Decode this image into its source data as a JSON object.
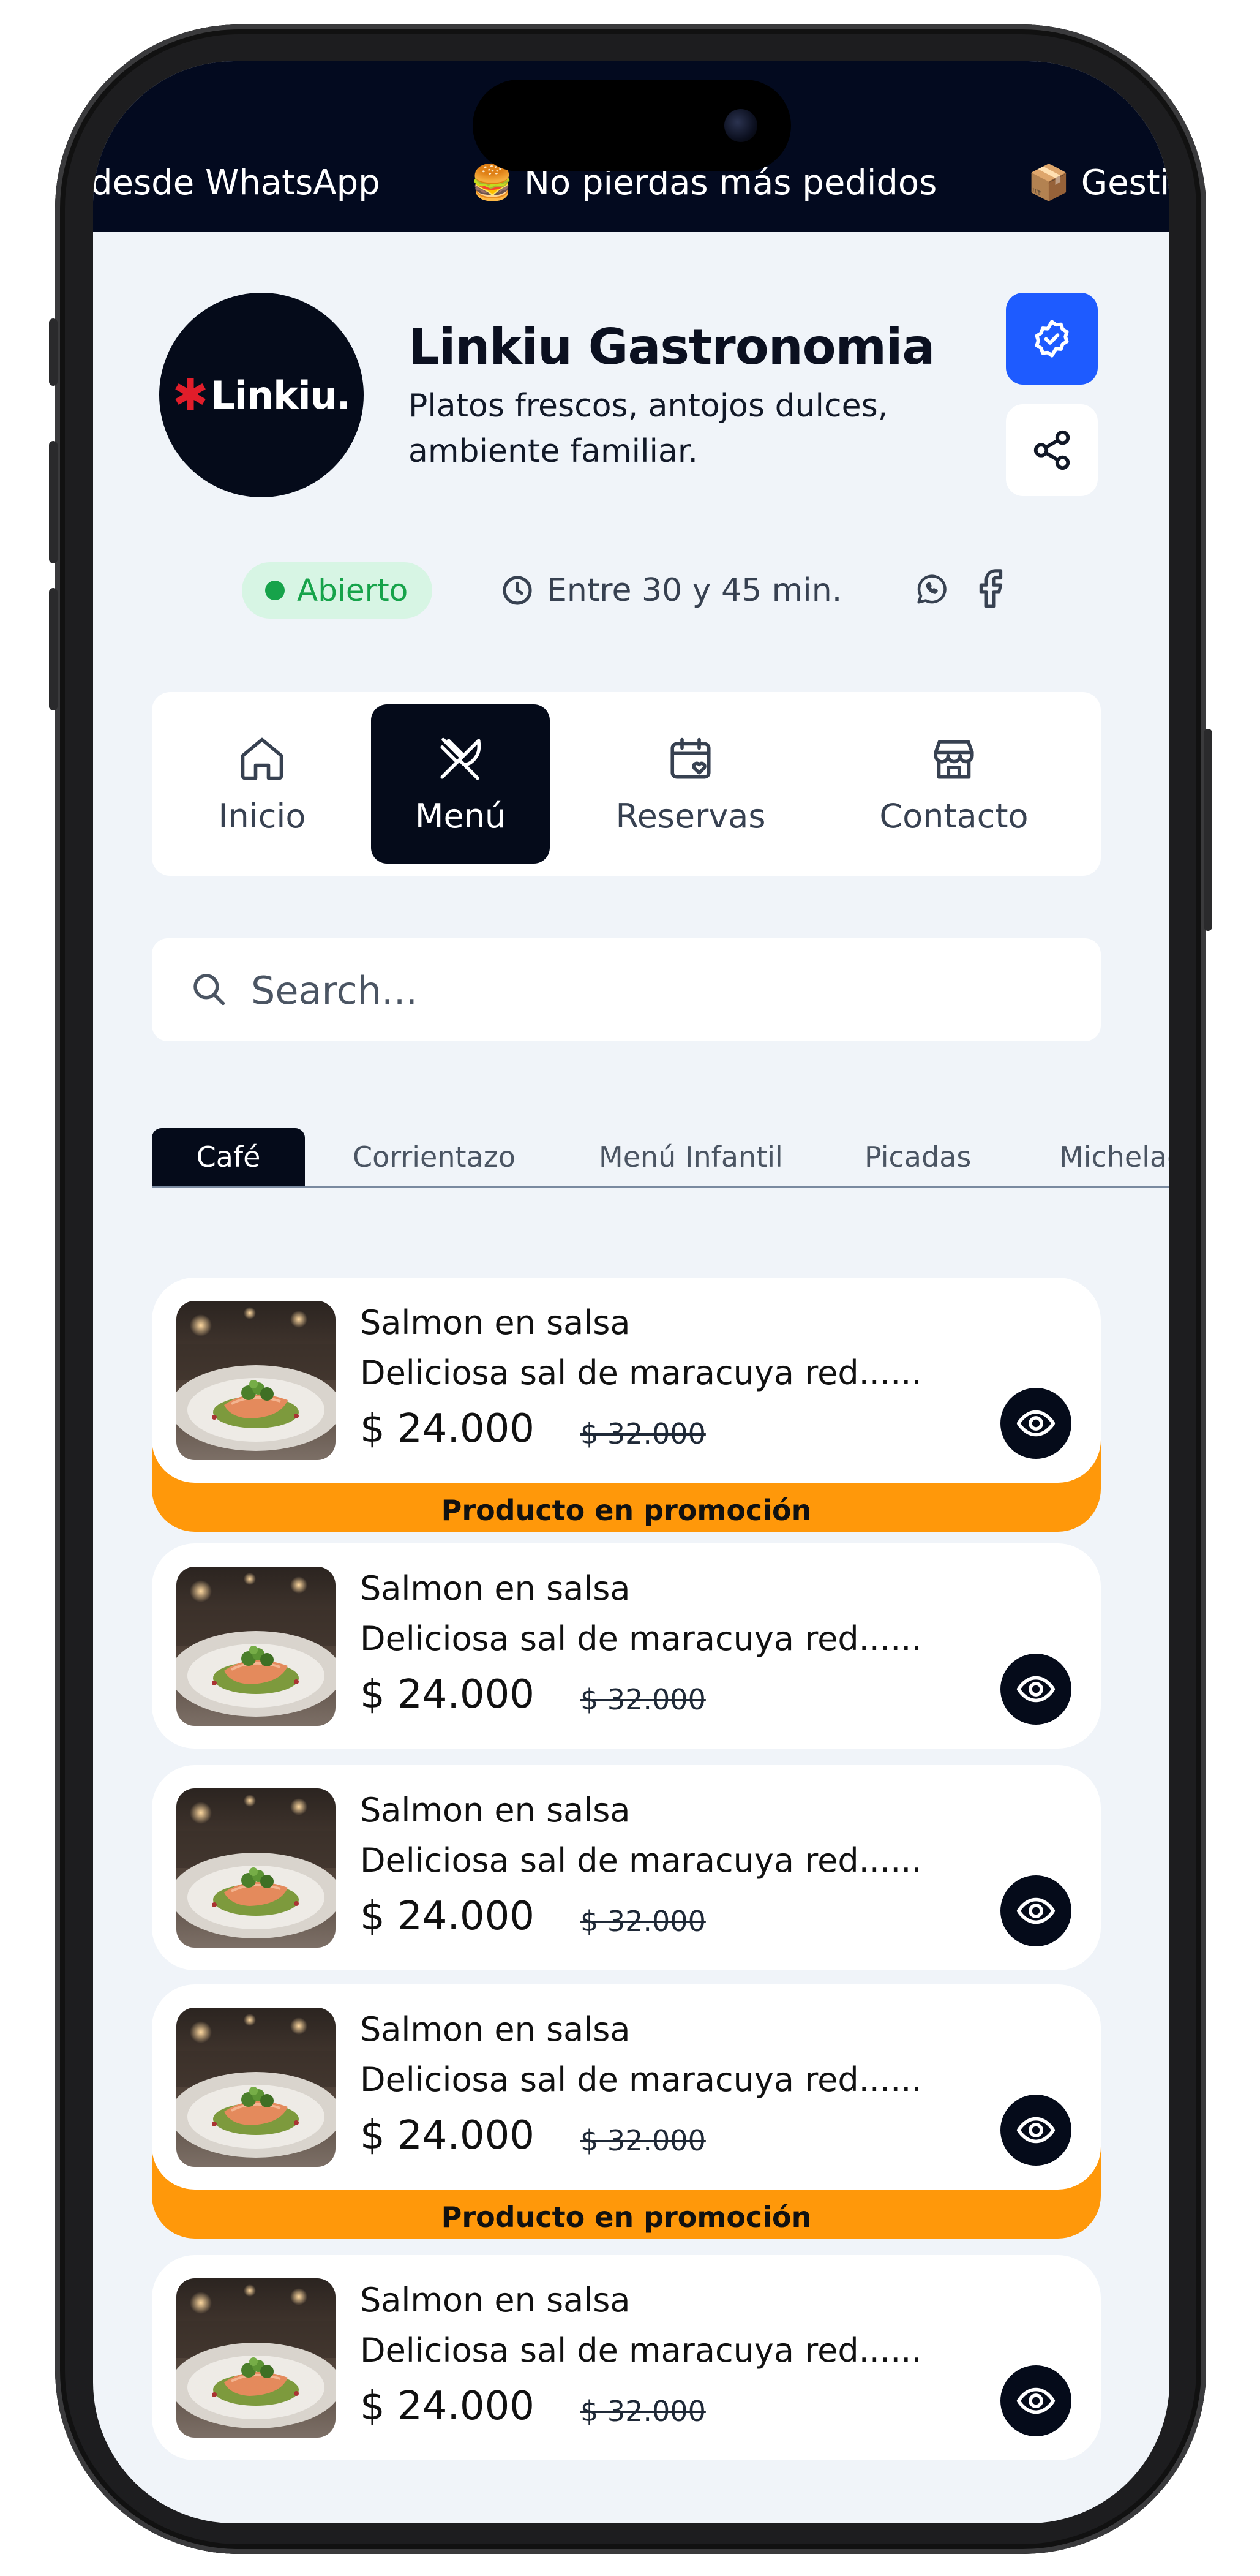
{
  "ticker": {
    "items": [
      "desde WhatsApp",
      "🍔 No pierdas más pedidos",
      "📦 Gestión"
    ]
  },
  "store": {
    "logo_text": "Linkiu.",
    "name": "Linkiu Gastronomia",
    "description": "Platos frescos, antojos dulces, ambiente familiar."
  },
  "status": {
    "open_label": "Abierto",
    "delivery_time": "Entre 30 y 45 min."
  },
  "nav": {
    "items": [
      {
        "label": "Inicio",
        "icon": "home-icon"
      },
      {
        "label": "Menú",
        "icon": "utensils-icon"
      },
      {
        "label": "Reservas",
        "icon": "calendar-heart-icon"
      },
      {
        "label": "Contacto",
        "icon": "store-icon"
      }
    ],
    "active": "Menú"
  },
  "search": {
    "placeholder": "Search..."
  },
  "categories": [
    "Café",
    "Corrientazo",
    "Menú Infantil",
    "Picadas",
    "Michelada"
  ],
  "active_category": "Café",
  "promo_label": "Producto en promoción",
  "products": [
    {
      "name": "Salmon en salsa",
      "description": "Deliciosa sal de maracuya red......",
      "price": "$ 24.000",
      "old_price": "$ 32.000",
      "promo": true
    },
    {
      "name": "Salmon en salsa",
      "description": "Deliciosa sal de maracuya red......",
      "price": "$ 24.000",
      "old_price": "$ 32.000",
      "promo": false
    },
    {
      "name": "Salmon en salsa",
      "description": "Deliciosa sal de maracuya red......",
      "price": "$ 24.000",
      "old_price": "$ 32.000",
      "promo": false
    },
    {
      "name": "Salmon en salsa",
      "description": "Deliciosa sal de maracuya red......",
      "price": "$ 24.000",
      "old_price": "$ 32.000",
      "promo": true
    },
    {
      "name": "Salmon en salsa",
      "description": "Deliciosa sal de maracuya red......",
      "price": "$ 24.000",
      "old_price": "$ 32.000",
      "promo": false
    }
  ],
  "colors": {
    "dark": "#050b1a",
    "accent_blue": "#1e5bff",
    "promo_orange": "#ff980a",
    "open_green": "#16a34a",
    "background": "#f0f4f9"
  }
}
